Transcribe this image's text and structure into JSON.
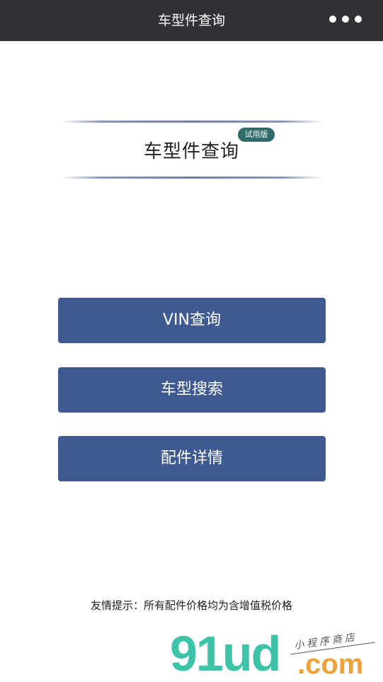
{
  "navbar": {
    "title": "车型件查询",
    "more_icon": "more-dots-icon"
  },
  "hero": {
    "title": "车型件查询",
    "badge": "试用版"
  },
  "buttons": [
    {
      "label": "VIN查询"
    },
    {
      "label": "车型搜索"
    },
    {
      "label": "配件详情"
    }
  ],
  "footer": {
    "tip": "友情提示：所有配件价格均为含增值税价格"
  },
  "watermark": {
    "main": "91ud",
    "domain": ".com",
    "caption": "小程序商店"
  },
  "colors": {
    "navbar": "#333135",
    "button": "#3e5a91",
    "badge": "#2f6b6a"
  }
}
